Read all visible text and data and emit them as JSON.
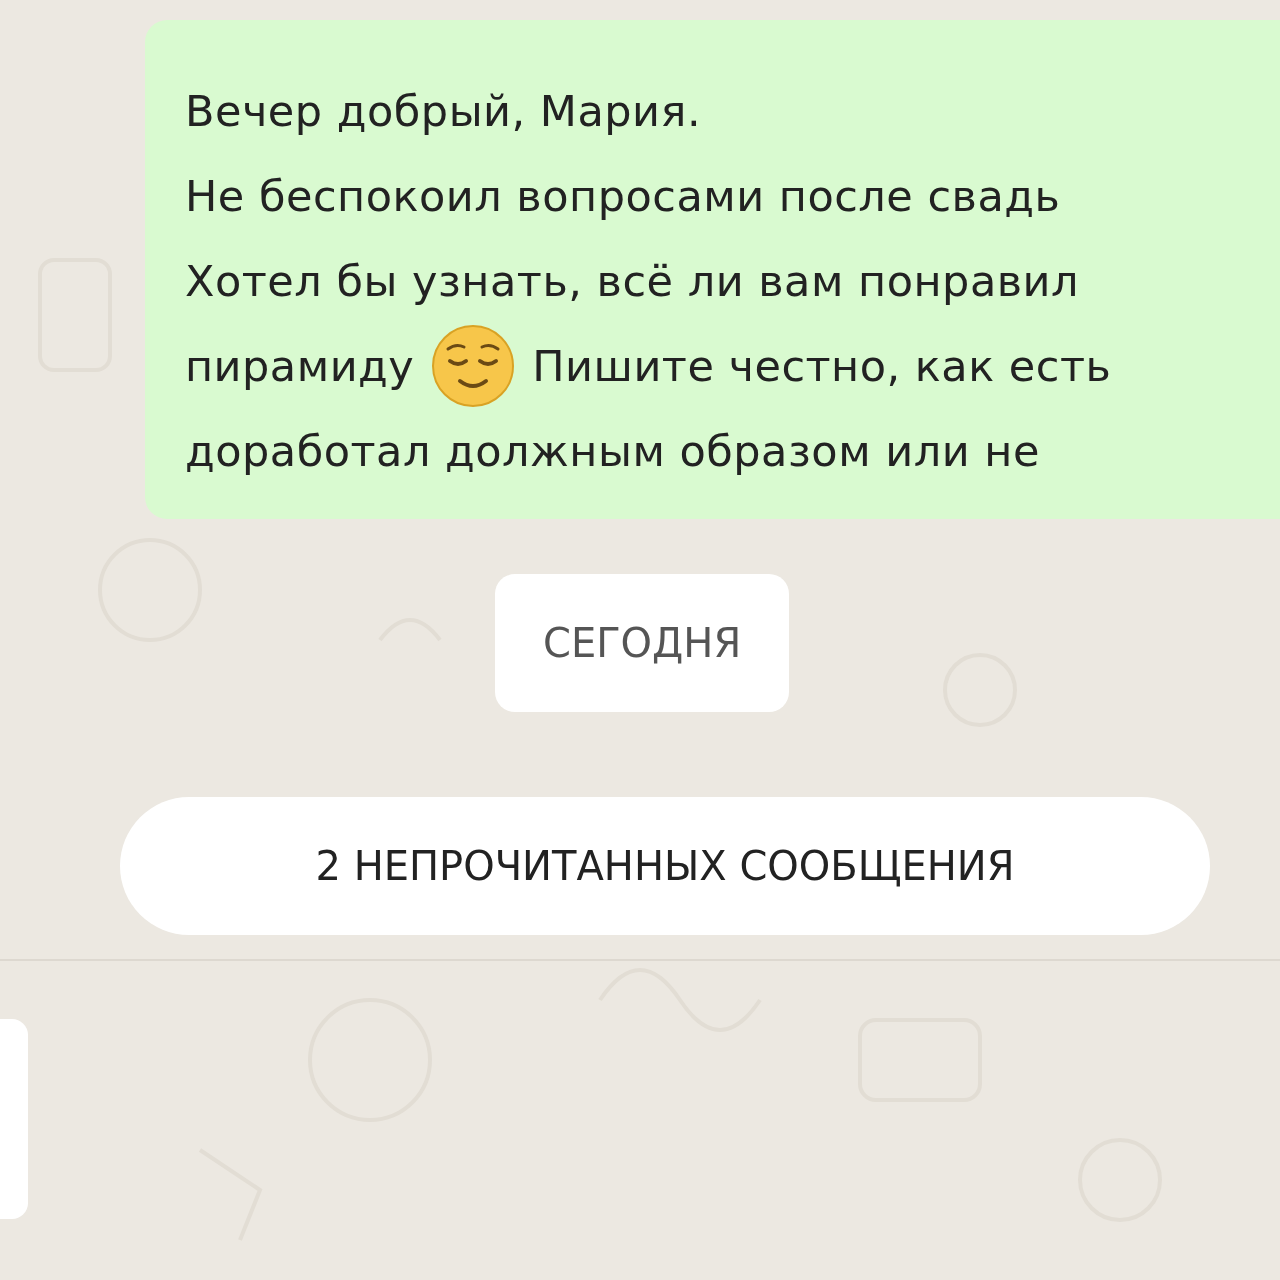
{
  "message": {
    "lines": [
      {
        "parts": [
          {
            "text": "Вечер добрый, Мария."
          }
        ]
      },
      {
        "parts": [
          {
            "text": "Не беспокоил вопросами после свадь"
          }
        ]
      },
      {
        "parts": [
          {
            "text": "Хотел бы узнать, всё ли вам понравил"
          }
        ]
      },
      {
        "parts": [
          {
            "text": "пирамиду"
          },
          {
            "kind": "emoji"
          },
          {
            "text": "Пишите честно, как есть"
          }
        ]
      },
      {
        "parts": [
          {
            "text": "доработал должным образом или не"
          }
        ]
      }
    ]
  },
  "date_chip": "СЕГОДНЯ",
  "unread_banner": "2 НЕПРОЧИТАННЫХ СООБЩЕНИЯ"
}
